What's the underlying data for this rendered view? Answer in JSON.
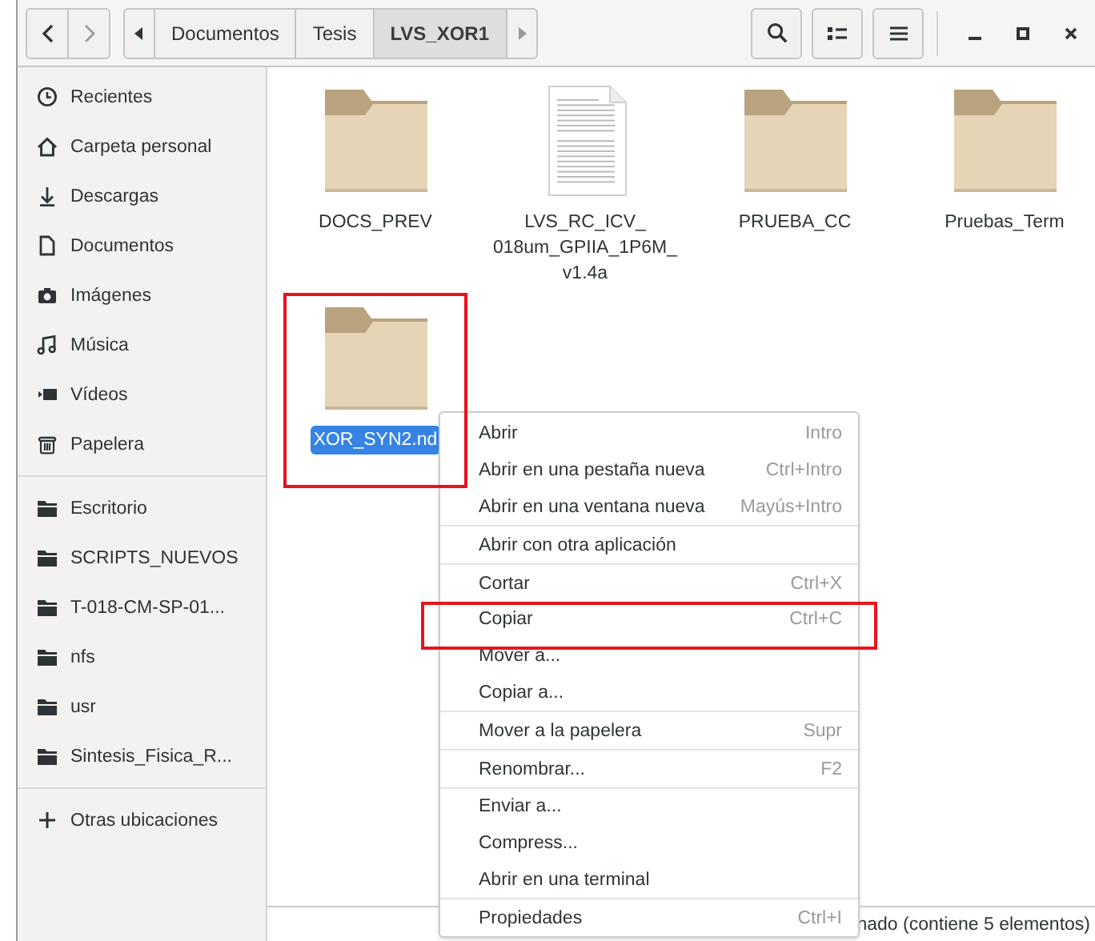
{
  "toolbar": {
    "breadcrumbs": [
      {
        "label": "Documentos",
        "selected": false
      },
      {
        "label": "Tesis",
        "selected": false
      },
      {
        "label": "LVS_XOR1",
        "selected": true
      }
    ]
  },
  "sidebar": {
    "sections": [
      {
        "items": [
          {
            "label": "Recientes"
          },
          {
            "label": "Carpeta personal"
          },
          {
            "label": "Descargas"
          },
          {
            "label": "Documentos"
          },
          {
            "label": "Imágenes"
          },
          {
            "label": "Música"
          },
          {
            "label": "Vídeos"
          },
          {
            "label": "Papelera"
          }
        ]
      },
      {
        "items": [
          {
            "label": "Escritorio"
          },
          {
            "label": "SCRIPTS_NUEVOS"
          },
          {
            "label": "T-018-CM-SP-01..."
          },
          {
            "label": "nfs"
          },
          {
            "label": "usr"
          },
          {
            "label": "Sintesis_Fisica_R..."
          }
        ]
      },
      {
        "items": [
          {
            "label": "Otras ubicaciones"
          }
        ]
      }
    ]
  },
  "files": [
    {
      "name": "DOCS_PREV",
      "kind": "folder",
      "selected": false
    },
    {
      "name": "LVS_RC_ICV_\n018um_GPIIA_1P6M_\nv1.4a",
      "kind": "document",
      "selected": false
    },
    {
      "name": "PRUEBA_CC",
      "kind": "folder",
      "selected": false
    },
    {
      "name": "Pruebas_Term",
      "kind": "folder",
      "selected": false
    },
    {
      "name": "XOR_SYN2.nd",
      "kind": "folder",
      "selected": true
    }
  ],
  "context_menu": {
    "sections": [
      {
        "items": [
          {
            "label": "Abrir",
            "shortcut": "Intro"
          },
          {
            "label": "Abrir en una pestaña nueva",
            "shortcut": "Ctrl+Intro"
          },
          {
            "label": "Abrir en una ventana nueva",
            "shortcut": "Mayús+Intro"
          }
        ]
      },
      {
        "items": [
          {
            "label": "Abrir con otra aplicación"
          }
        ]
      },
      {
        "items": [
          {
            "label": "Cortar",
            "shortcut": "Ctrl+X"
          },
          {
            "label": "Copiar",
            "shortcut": "Ctrl+C"
          },
          {
            "label": "Mover a..."
          },
          {
            "label": "Copiar a..."
          }
        ]
      },
      {
        "items": [
          {
            "label": "Mover a la papelera",
            "shortcut": "Supr"
          }
        ]
      },
      {
        "items": [
          {
            "label": "Renombrar...",
            "shortcut": "F2"
          }
        ]
      },
      {
        "items": [
          {
            "label": "Enviar a..."
          },
          {
            "label": "Compress..."
          },
          {
            "label": "Abrir en una terminal"
          }
        ]
      },
      {
        "items": [
          {
            "label": "Propiedades",
            "shortcut": "Ctrl+I"
          }
        ]
      }
    ]
  },
  "status_bar": {
    "text": "nado (contiene 5 elementos)"
  }
}
